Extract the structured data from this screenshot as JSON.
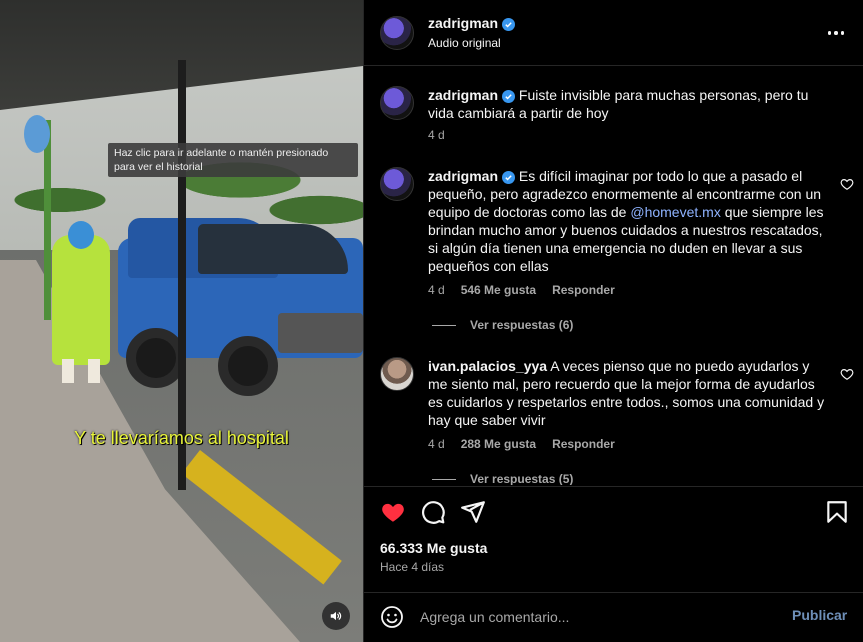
{
  "media": {
    "tooltip": "Haz clic para ir adelante o mantén presionado para ver el historial",
    "caption": "Y te llevaríamos al hospital",
    "mute_icon": "speaker-icon"
  },
  "header": {
    "username": "zadrigman",
    "subtitle": "Audio original",
    "more_icon": "more-horizontal-icon"
  },
  "comments": [
    {
      "username": "zadrigman",
      "verified": true,
      "text": "Fuiste invisible para muchas personas, pero tu vida cambiará a partir de hoy",
      "time": "4 d"
    },
    {
      "username": "zadrigman",
      "verified": true,
      "text_before": "Es difícil imaginar por todo lo que a pasado el pequeño, pero agradezco enormemente al encontrarme con un equipo de doctoras como las de ",
      "mention": "@homevet.mx",
      "text_after": " que siempre les brindan mucho amor y buenos cuidados a nuestros rescatados, si algún día tienen una emergencia no duden en llevar a sus pequeños con ellas",
      "time": "4 d",
      "likes": "546 Me gusta",
      "reply": "Responder",
      "view_replies": "Ver respuestas (6)"
    },
    {
      "username": "ivan.palacios_yya",
      "verified": false,
      "text": "A veces pienso que no puedo ayudarlos y me siento mal, pero recuerdo que la mejor forma de ayudarlos es cuidarlos y respetarlos entre todos., somos una comunidad y hay que saber vivir",
      "time": "4 d",
      "likes": "288 Me gusta",
      "reply": "Responder",
      "view_replies": "Ver respuestas (5)"
    }
  ],
  "actions": {
    "like_icon": "heart-filled-icon",
    "comment_icon": "comment-icon",
    "share_icon": "send-icon",
    "save_icon": "bookmark-icon",
    "like_color": "#ff3040"
  },
  "stats": {
    "likes": "66.333 Me gusta",
    "time_ago": "Hace 4 días"
  },
  "add_comment": {
    "placeholder": "Agrega un comentario...",
    "post_label": "Publicar"
  }
}
